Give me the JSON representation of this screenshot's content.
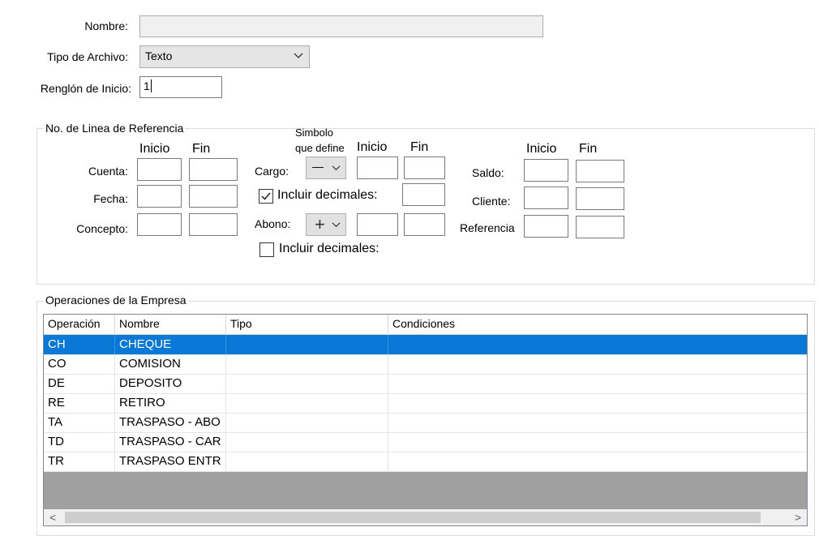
{
  "form": {
    "nombre_label": "Nombre:",
    "nombre_value": "",
    "tipo_label": "Tipo de Archivo:",
    "tipo_value": "Texto",
    "renglon_label": "Renglón de Inicio:",
    "renglon_value": "1"
  },
  "referencia": {
    "title": "No. de Linea de Referencia",
    "col_inicio": "Inicio",
    "col_fin": "Fin",
    "simbolo_line1": "Simbolo",
    "simbolo_line2": "que define",
    "cuenta_label": "Cuenta:",
    "fecha_label": "Fecha:",
    "concepto_label": "Concepto:",
    "cargo_label": "Cargo:",
    "cargo_symbol": "—",
    "abono_label": "Abono:",
    "abono_symbol": "+",
    "incluir_cargo_label": "Incluir decimales:",
    "incluir_cargo_checked": true,
    "incluir_abono_label": "Incluir decimales:",
    "incluir_abono_checked": false,
    "saldo_label": "Saldo:",
    "cliente_label": "Cliente:",
    "referencia_label": "Referencia"
  },
  "operaciones": {
    "title": "Operaciones de la Empresa",
    "columns": [
      "Operación",
      "Nombre",
      "Tipo",
      "Condiciones"
    ],
    "rows": [
      {
        "op": "CH",
        "nombre": "CHEQUE",
        "tipo": "",
        "cond": ""
      },
      {
        "op": "CO",
        "nombre": "COMISION",
        "tipo": "",
        "cond": ""
      },
      {
        "op": "DE",
        "nombre": "DEPOSITO",
        "tipo": "",
        "cond": ""
      },
      {
        "op": "RE",
        "nombre": "RETIRO",
        "tipo": "",
        "cond": ""
      },
      {
        "op": "TA",
        "nombre": "TRASPASO - ABO",
        "tipo": "",
        "cond": ""
      },
      {
        "op": "TD",
        "nombre": "TRASPASO - CAR",
        "tipo": "",
        "cond": ""
      },
      {
        "op": "TR",
        "nombre": "TRASPASO ENTR",
        "tipo": "",
        "cond": ""
      }
    ],
    "selected_row": 0
  },
  "icons": {
    "dropdown": "chevron-down-icon",
    "scroll_left": "scroll-left-icon",
    "scroll_right": "scroll-right-icon",
    "checkbox_checked": "check-icon"
  },
  "colors": {
    "selection": "#0a78d7",
    "grid_empty": "#a0a0a0"
  }
}
